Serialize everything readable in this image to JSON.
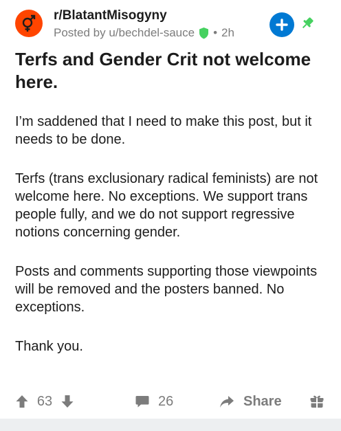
{
  "post": {
    "subreddit": "r/BlatantMisogyny",
    "posted_by": "Posted by u/bechdel-sauce",
    "separator": "•",
    "age": "2h",
    "title": "Terfs and Gender Crit not welcome here.",
    "body": [
      "I’m saddened that I need to make this post, but it needs to be done.",
      "Terfs (trans exclusionary radical feminists) are not welcome here. No exceptions. We support trans people fully, and we do not support regressive notions concerning gender.",
      "Posts and comments supporting those viewpoints will be removed and the posters banned. No exceptions.",
      "Thank you."
    ]
  },
  "actions": {
    "votes": "63",
    "comments": "26",
    "share_label": "Share"
  },
  "icons": {
    "avatar": "gender-symbol-icon",
    "mod": "mod-shield-icon",
    "join": "plus-icon",
    "pin": "pin-icon",
    "upvote": "upvote-arrow-icon",
    "downvote": "downvote-arrow-icon",
    "comment": "comment-bubble-icon",
    "share": "share-arrow-icon",
    "award": "award-gift-icon"
  },
  "colors": {
    "subreddit_avatar": "#ff4500",
    "join_button": "#0079d3",
    "mod_shield": "#46d160",
    "pin": "#46d160",
    "meta_text": "#7c7c7c"
  }
}
